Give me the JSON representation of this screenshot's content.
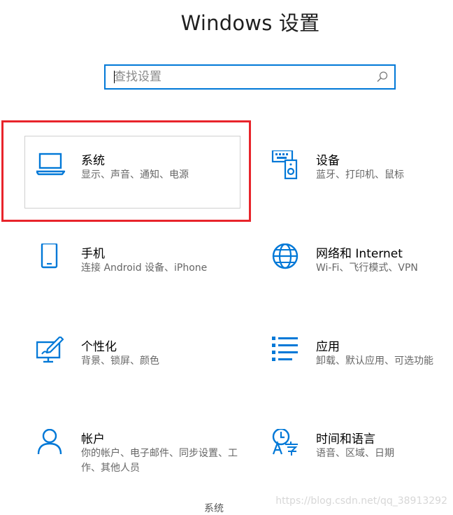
{
  "window": {
    "title": "Windows 设置"
  },
  "search": {
    "placeholder": "查找设置",
    "value": ""
  },
  "tiles": [
    {
      "id": "system",
      "title": "系统",
      "description": "显示、声音、通知、电源",
      "icon": "laptop-icon",
      "highlighted": true
    },
    {
      "id": "devices",
      "title": "设备",
      "description": "蓝牙、打印机、鼠标",
      "icon": "devices-icon"
    },
    {
      "id": "phone",
      "title": "手机",
      "description": "连接 Android 设备、iPhone",
      "icon": "phone-icon"
    },
    {
      "id": "network",
      "title": "网络和 Internet",
      "description": "Wi-Fi、飞行模式、VPN",
      "icon": "globe-icon"
    },
    {
      "id": "personalization",
      "title": "个性化",
      "description": "背景、锁屏、颜色",
      "icon": "personalization-icon"
    },
    {
      "id": "apps",
      "title": "应用",
      "description": "卸载、默认应用、可选功能",
      "icon": "apps-icon"
    },
    {
      "id": "accounts",
      "title": "帐户",
      "description": "你的帐户、电子邮件、同步设置、工作、其他人员",
      "icon": "person-icon"
    },
    {
      "id": "time-language",
      "title": "时间和语言",
      "description": "语音、区域、日期",
      "icon": "time-language-icon"
    }
  ],
  "tooltip": {
    "text": "系统"
  },
  "watermark": {
    "text": "https://blog.csdn.net/qq_38913292"
  },
  "colors": {
    "accent": "#0078d7",
    "highlight": "#e8242b",
    "description_text": "#666666"
  }
}
